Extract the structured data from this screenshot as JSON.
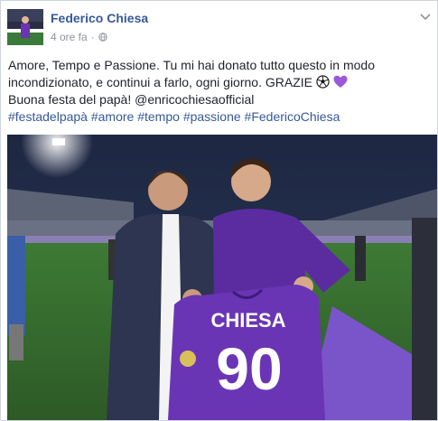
{
  "post": {
    "author": "Federico Chiesa",
    "time": "4 ore fa",
    "time_separator": "·",
    "privacy_icon": "globe-icon",
    "caption_lines": [
      "Amore, Tempo e Passione. Tu mi hai donato tutto questo in modo",
      "incondizionato, e continui a farlo, ogni giorno. GRAZIE",
      "Buona festa del papà! @enricochiesaofficial"
    ],
    "hashtags": [
      "#festadelpapà",
      "#amore",
      "#tempo",
      "#passione",
      "#FedericoChiesa"
    ],
    "emoji_after_line2": [
      "soccer-ball-icon",
      "purple-heart-icon"
    ]
  },
  "photo": {
    "jersey_name": "CHIESA",
    "jersey_number": "90"
  },
  "colors": {
    "link": "#365899",
    "text": "#1d2129",
    "meta": "#90949c",
    "fiorentina_purple": "#5a2ca0"
  }
}
